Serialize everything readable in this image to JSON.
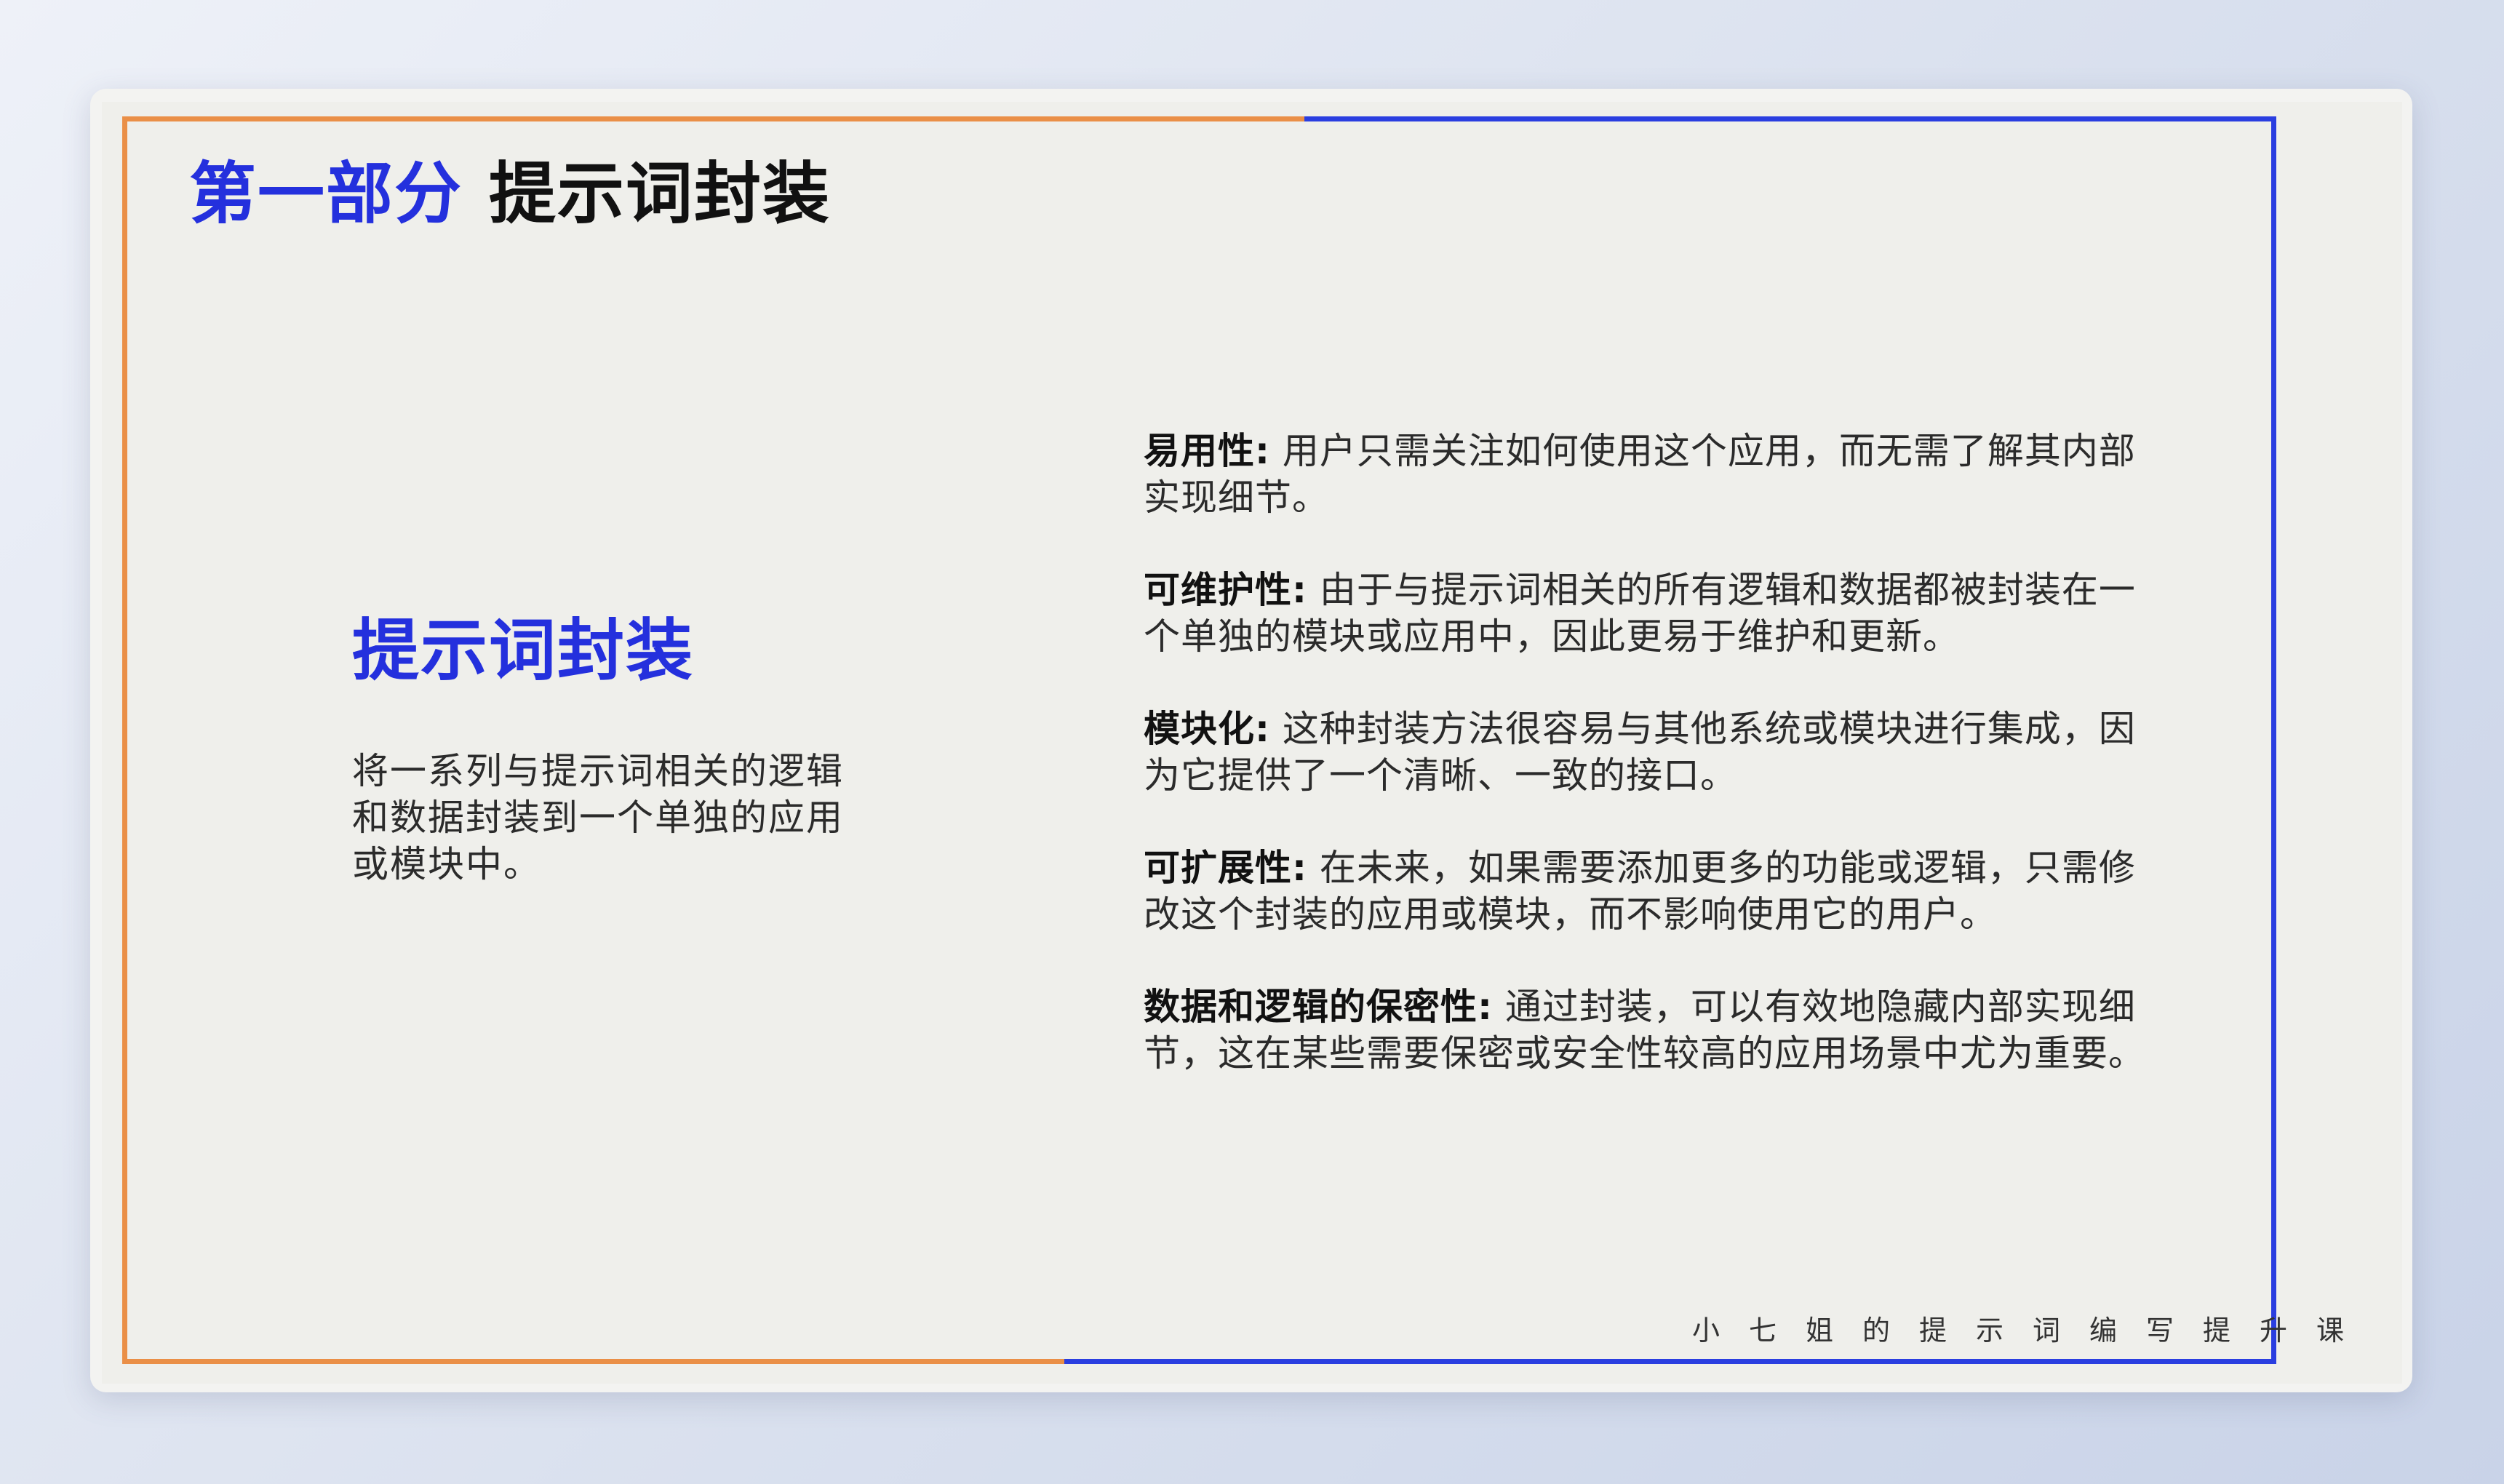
{
  "header": {
    "part_label": "第一部分",
    "title": "提示词封装"
  },
  "left": {
    "heading": "提示词封装",
    "description": "将一系列与提示词相关的逻辑和数据封装到一个单独的应用或模块中。"
  },
  "points": [
    {
      "term": "易用性:",
      "text": "用户只需关注如何使用这个应用，而无需了解其内部实现细节。"
    },
    {
      "term": "可维护性:",
      "text": "由于与提示词相关的所有逻辑和数据都被封装在一个单独的模块或应用中，因此更易于维护和更新。"
    },
    {
      "term": "模块化:",
      "text": "这种封装方法很容易与其他系统或模块进行集成，因为它提供了一个清晰、一致的接口。"
    },
    {
      "term": "可扩展性:",
      "text": "在未来，如果需要添加更多的功能或逻辑，只需修改这个封装的应用或模块，而不影响使用它的用户。"
    },
    {
      "term": "数据和逻辑的保密性:",
      "text": "通过封装，可以有效地隐藏内部实现细节，这在某些需要保密或安全性较高的应用场景中尤为重要。"
    }
  ],
  "footer": {
    "brand": "小七姐的提示词编写提升课"
  },
  "colors": {
    "accent_blue": "#2430dd",
    "frame_orange": "#ea8f47",
    "frame_blue": "#2a3ee0",
    "slide_background": "#efefeb"
  }
}
